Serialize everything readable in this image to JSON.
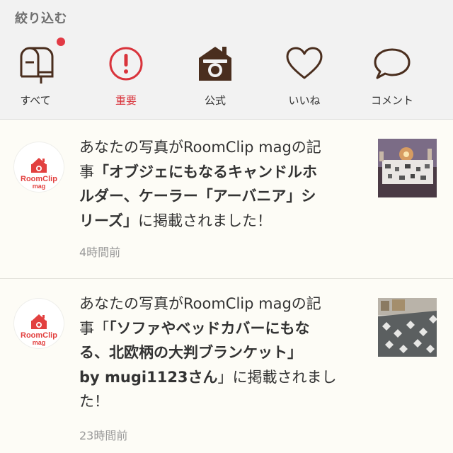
{
  "filter": {
    "title": "絞り込む",
    "tabs": [
      {
        "label": "すべて",
        "icon": "mailbox-icon",
        "badge": true
      },
      {
        "label": "重要",
        "icon": "important-icon",
        "active": true
      },
      {
        "label": "公式",
        "icon": "official-camera-icon"
      },
      {
        "label": "いいね",
        "icon": "heart-icon"
      },
      {
        "label": "コメント",
        "icon": "comment-icon"
      }
    ]
  },
  "notifications": [
    {
      "avatar_logo_line1": "RoomClip",
      "avatar_logo_line2": "mag",
      "line1": "あなたの写真がRoomClip magの記",
      "line2_prefix": "事",
      "line2_bold": "「オブジェにもなるキャンドルホ",
      "line3_bold": "ルダー、ケーラー「アーバニア」シ",
      "line4_bold": "リーズ」",
      "line4_rest": "に掲載されました！",
      "time": "4時間前"
    },
    {
      "avatar_logo_line1": "RoomClip",
      "avatar_logo_line2": "mag",
      "line1": "あなたの写真がRoomClip magの記",
      "line2_prefix": "事「",
      "line2_bold": "「ソファやベッドカバーにもな",
      "line3_bold": "る、北欧柄の大判ブランケット」",
      "line4_bold": "by mugi1123さん",
      "line4_rest": "」に掲載されまし",
      "line5": "た！",
      "time": "23時間前"
    }
  ],
  "colors": {
    "accent": "#d9343c",
    "brand_red": "#e2403f",
    "icon_brown": "#4a2e1e"
  }
}
